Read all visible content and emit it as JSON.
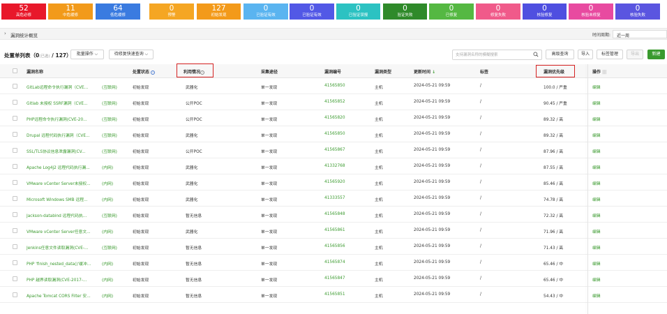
{
  "stats": [
    {
      "value": "52",
      "label": "高危必修",
      "color": "#e8182a"
    },
    {
      "value": "11",
      "label": "中危缓修",
      "color": "#f29a1a"
    },
    {
      "value": "64",
      "label": "低危缓修",
      "color": "#3a7be0"
    },
    {
      "value": "0",
      "label": "预警",
      "color": "#f5a623"
    },
    {
      "value": "127",
      "label": "初始发现",
      "color": "#f39a1a"
    },
    {
      "value": "0",
      "label": "已验证有效",
      "color": "#5ab4f0"
    },
    {
      "value": "0",
      "label": "已验证有效",
      "color": "#5258e6"
    },
    {
      "value": "0",
      "label": "已验证误报",
      "color": "#2cc2c2"
    },
    {
      "value": "0",
      "label": "验证失败",
      "color": "#2f8a2a"
    },
    {
      "value": "0",
      "label": "已修复",
      "color": "#55b842"
    },
    {
      "value": "0",
      "label": "修复失败",
      "color": "#f05a8a"
    },
    {
      "value": "0",
      "label": "核验修复",
      "color": "#4f4fe0"
    },
    {
      "value": "0",
      "label": "核验未修复",
      "color": "#e84aa0"
    },
    {
      "value": "0",
      "label": "核验失败",
      "color": "#5a55e0"
    }
  ],
  "summary": {
    "title": "漏洞统计概览",
    "period_label": "时间周期:",
    "period_value": "近一周"
  },
  "toolbar": {
    "list_title": "处置单列表（0",
    "list_selected": "(已选)",
    "list_total": "/ 127）",
    "batch_label": "批量操作 ⌵",
    "quick_query_label": "待修复快速查询 ⌵",
    "search_placeholder": "支持漏洞名称的模糊搜索",
    "advanced_query": "高级查询",
    "import": "导入",
    "tag_manage": "标签管理",
    "export": "导出",
    "new": "新建"
  },
  "columns": {
    "name": "漏洞名称",
    "status": "处置状态",
    "exploit": "利用情况",
    "collect": "采集途径",
    "id": "漏洞编号",
    "type": "漏洞类型",
    "updated": "更新时间",
    "updated_sort": "↓",
    "tags": "标签",
    "priority": "漏洞优先级",
    "action": "操作",
    "action_icon": "|||"
  },
  "rows": [
    {
      "name": "GitLab远程命令执行漏洞（CVE...",
      "network": "(互联网)",
      "status": "初始发现",
      "exploit": "武器化",
      "collect": "单一发现",
      "id": "41565850",
      "type": "主机",
      "updated": "2024-05-21 09:59",
      "tags": "/",
      "priority": "100.0 / 严重",
      "action": "编辑"
    },
    {
      "name": "Gitlab 未授权 SSRF漏洞（CVE...",
      "network": "(互联网)",
      "status": "初始发现",
      "exploit": "公开POC",
      "collect": "单一发现",
      "id": "41565852",
      "type": "主机",
      "updated": "2024-05-21 09:59",
      "tags": "/",
      "priority": "90.45 / 严重",
      "action": "编辑"
    },
    {
      "name": "PHP远程命令执行漏洞(CVE-20...",
      "network": "(互联网)",
      "status": "初始发现",
      "exploit": "公开POC",
      "collect": "单一发现",
      "id": "41565820",
      "type": "主机",
      "updated": "2024-05-21 09:59",
      "tags": "/",
      "priority": "89.32 / 高",
      "action": "编辑"
    },
    {
      "name": "Drupal 远程代码执行漏洞（CVE...",
      "network": "(互联网)",
      "status": "初始发现",
      "exploit": "武器化",
      "collect": "单一发现",
      "id": "41565850",
      "type": "主机",
      "updated": "2024-05-21 09:59",
      "tags": "/",
      "priority": "89.32 / 高",
      "action": "编辑"
    },
    {
      "name": "SSL/TLS协议信息泄露漏洞(CV...",
      "network": "(互联网)",
      "status": "初始发现",
      "exploit": "公开POC",
      "collect": "单一发现",
      "id": "41565867",
      "type": "主机",
      "updated": "2024-05-21 09:59",
      "tags": "/",
      "priority": "87.96 / 高",
      "action": "编辑"
    },
    {
      "name": "Apache Log4j2 远程代码执行漏...",
      "network": "(内网)",
      "status": "初始发现",
      "exploit": "武器化",
      "collect": "单一发现",
      "id": "41332768",
      "type": "主机",
      "updated": "2024-05-21 09:59",
      "tags": "/",
      "priority": "87.55 / 高",
      "action": "编辑"
    },
    {
      "name": "VMware vCenter Server未授权...",
      "network": "(内网)",
      "status": "初始发现",
      "exploit": "武器化",
      "collect": "单一发现",
      "id": "41565920",
      "type": "主机",
      "updated": "2024-05-21 09:59",
      "tags": "/",
      "priority": "85.46 / 高",
      "action": "编辑"
    },
    {
      "name": "Microsoft Windows SMB 远程...",
      "network": "(内网)",
      "status": "初始发现",
      "exploit": "武器化",
      "collect": "单一发现",
      "id": "41333557",
      "type": "主机",
      "updated": "2024-05-21 09:59",
      "tags": "/",
      "priority": "74.78 / 高",
      "action": "编辑"
    },
    {
      "name": "Jackson-databind 远程代码执...",
      "network": "(互联网)",
      "status": "初始发现",
      "exploit": "暂无信息",
      "collect": "单一发现",
      "id": "41565848",
      "type": "主机",
      "updated": "2024-05-21 09:59",
      "tags": "/",
      "priority": "72.32 / 高",
      "action": "编辑"
    },
    {
      "name": "VMware vCenter Server任意文...",
      "network": "(内网)",
      "status": "初始发现",
      "exploit": "武器化",
      "collect": "单一发现",
      "id": "41565861",
      "type": "主机",
      "updated": "2024-05-21 09:59",
      "tags": "/",
      "priority": "71.96 / 高",
      "action": "编辑"
    },
    {
      "name": "Jenkins任意文件读取漏洞(CVE-...",
      "network": "(互联网)",
      "status": "初始发现",
      "exploit": "暂无信息",
      "collect": "单一发现",
      "id": "41565856",
      "type": "主机",
      "updated": "2024-05-21 09:59",
      "tags": "/",
      "priority": "71.43 / 高",
      "action": "编辑"
    },
    {
      "name": "PHP 'finish_nested_data()'缓冲...",
      "network": "(内网)",
      "status": "初始发现",
      "exploit": "暂无信息",
      "collect": "单一发现",
      "id": "41565874",
      "type": "主机",
      "updated": "2024-05-21 09:59",
      "tags": "/",
      "priority": "65.46 / 中",
      "action": "编辑"
    },
    {
      "name": "PHP 越界读取漏洞(CVE-2017-...",
      "network": "(内网)",
      "status": "初始发现",
      "exploit": "暂无信息",
      "collect": "单一发现",
      "id": "41565847",
      "type": "主机",
      "updated": "2024-05-21 09:59",
      "tags": "/",
      "priority": "65.46 / 中",
      "action": "编辑"
    },
    {
      "name": "Apache Tomcat CORS Filter 安...",
      "network": "(内网)",
      "status": "初始发现",
      "exploit": "暂无信息",
      "collect": "单一发现",
      "id": "41565851",
      "type": "主机",
      "updated": "2024-05-21 09:59",
      "tags": "/",
      "priority": "54.43 / 中",
      "action": "编辑"
    }
  ]
}
